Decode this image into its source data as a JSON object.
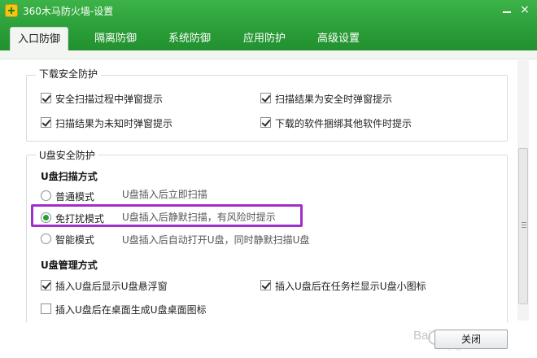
{
  "window": {
    "title": "360木马防火墙-设置",
    "logo_icon": "360-plus-icon",
    "min_icon": "minimize-icon",
    "close_icon": "close-x-icon",
    "close_glyph": "×"
  },
  "tabs": [
    {
      "label": "入口防御",
      "active": true
    },
    {
      "label": "隔离防御",
      "active": false
    },
    {
      "label": "系统防御",
      "active": false
    },
    {
      "label": "应用防护",
      "active": false
    },
    {
      "label": "高级设置",
      "active": false
    }
  ],
  "download_group": {
    "legend": "下载安全防护",
    "options": [
      {
        "label": "安全扫描过程中弹窗提示",
        "checked": true
      },
      {
        "label": "扫描结果为安全时弹窗提示",
        "checked": true
      },
      {
        "label": "扫描结果为未知时弹窗提示",
        "checked": true
      },
      {
        "label": "下载的软件捆绑其他软件时提示",
        "checked": true
      }
    ]
  },
  "usb_group": {
    "legend": "U盘安全防护",
    "scan_title": "U盘扫描方式",
    "scan_modes": [
      {
        "label": "普通模式",
        "desc": "U盘插入后立即扫描",
        "selected": false
      },
      {
        "label": "免打扰模式",
        "desc": "U盘插入后静默扫描，有风险时提示",
        "selected": true
      },
      {
        "label": "智能模式",
        "desc": "U盘插入后自动打开U盘，同时静默扫描U盘",
        "selected": false
      }
    ],
    "manage_title": "U盘管理方式",
    "manage_options": [
      {
        "label": "插入U盘后显示U盘悬浮窗",
        "checked": true
      },
      {
        "label": "插入U盘后在任务栏显示U盘小图标",
        "checked": true
      },
      {
        "label": "插入U盘后在桌面生成U盘桌面图标",
        "checked": false
      }
    ]
  },
  "footer": {
    "close_label": "关闭",
    "watermark": "Bai",
    "watermark_text": "经验",
    "watermark_sub": "jingyan.baidu.com"
  },
  "colors": {
    "header_green": "#2a9d37",
    "highlight_purple": "#a12fc9",
    "radio_green": "#21a132"
  }
}
